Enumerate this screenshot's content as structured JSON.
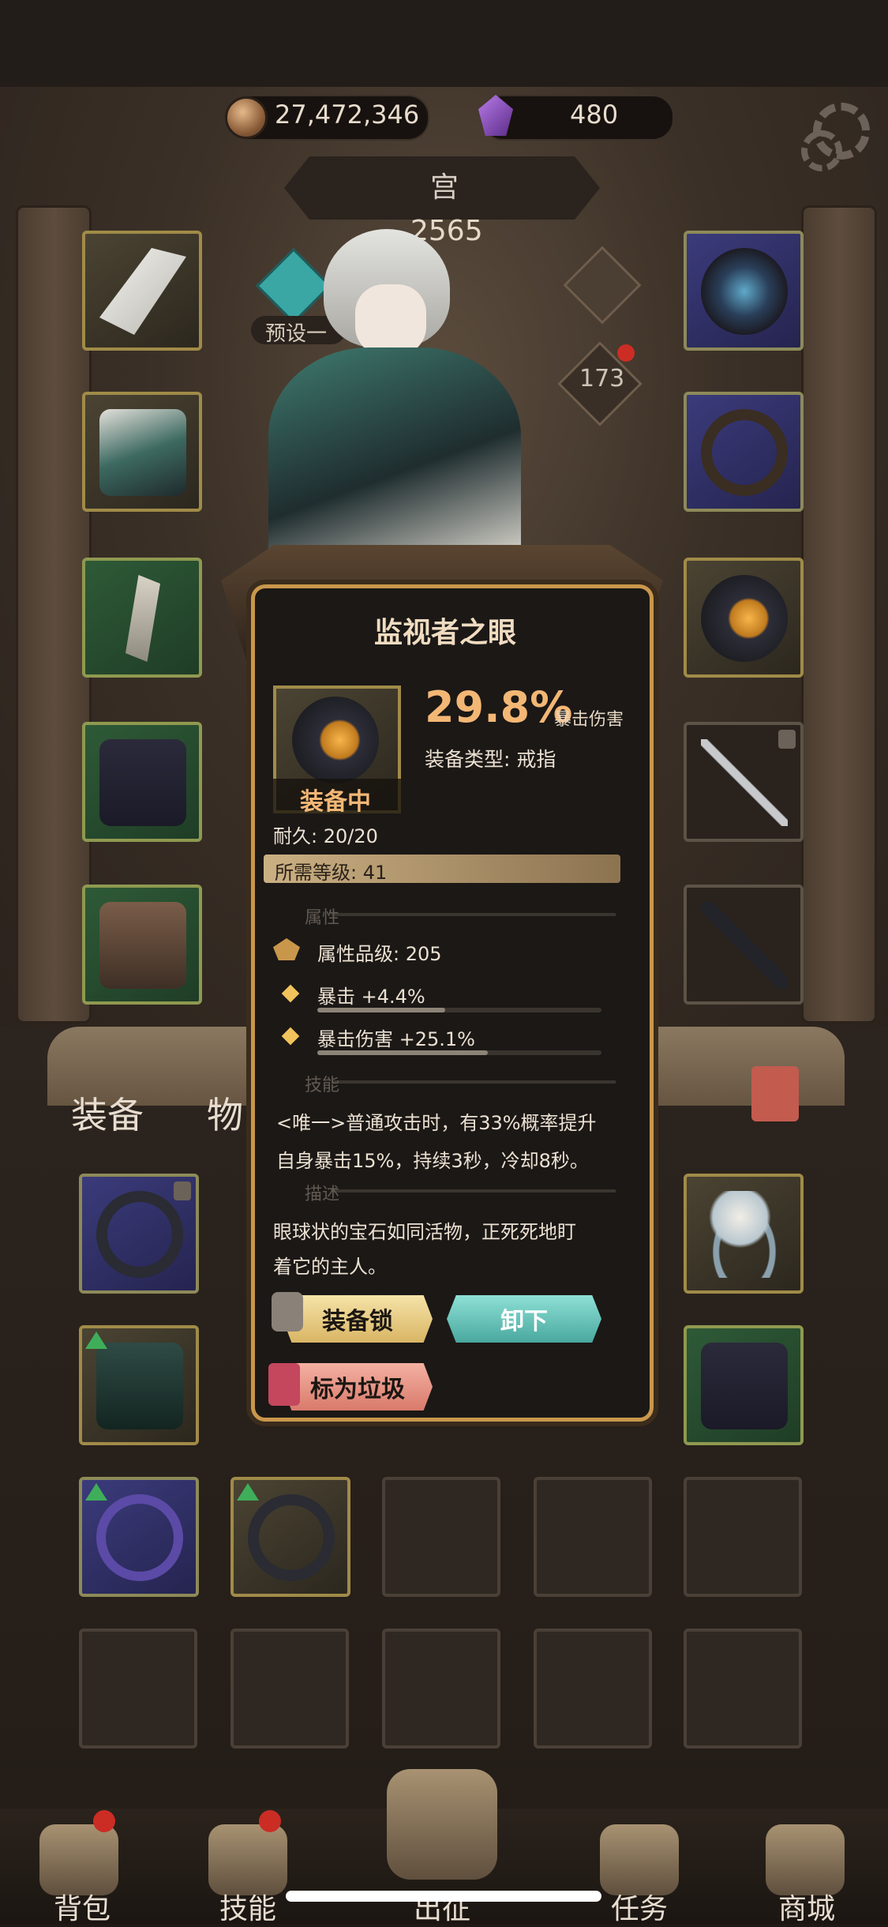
{
  "currency": {
    "gold": "27,472,346",
    "gems": "480"
  },
  "character": {
    "name": "宫",
    "power": "2565",
    "preset": "预设一",
    "level": "173"
  },
  "bag_tabs": {
    "equip": "装备",
    "items": "物"
  },
  "popup": {
    "title": "监视者之眼",
    "equipped_label": "装备中",
    "main_stat_value": "29.8%",
    "main_stat_name": "暴击伤害",
    "type_label": "装备类型: 戒指",
    "durability": "耐久: 20/20",
    "required_level": "所需等级: 41",
    "section_attr": "属性",
    "attr_grade": "属性品级: 205",
    "attrs": [
      {
        "text": "暴击 +4.4%",
        "fill": 0.45
      },
      {
        "text": "暴击伤害 +25.1%",
        "fill": 0.6
      }
    ],
    "section_skill": "技能",
    "skill_line1": "<唯一>普通攻击时，有33%概率提升",
    "skill_line2": "自身暴击15%，持续3秒，冷却8秒。",
    "section_desc": "描述",
    "desc_line1": "眼球状的宝石如同活物，正死死地盯",
    "desc_line2": "着它的主人。",
    "btn_lock": "装备锁",
    "btn_unequip": "卸下",
    "btn_junk": "标为垃圾"
  },
  "nav": {
    "bag": "背包",
    "skills": "技能",
    "battle": "出征",
    "tasks": "任务",
    "shop": "商城"
  },
  "colors": {
    "accent_gold": "#c9974b",
    "stat_orange": "#f3b775",
    "teal_button": "#49a89f"
  }
}
